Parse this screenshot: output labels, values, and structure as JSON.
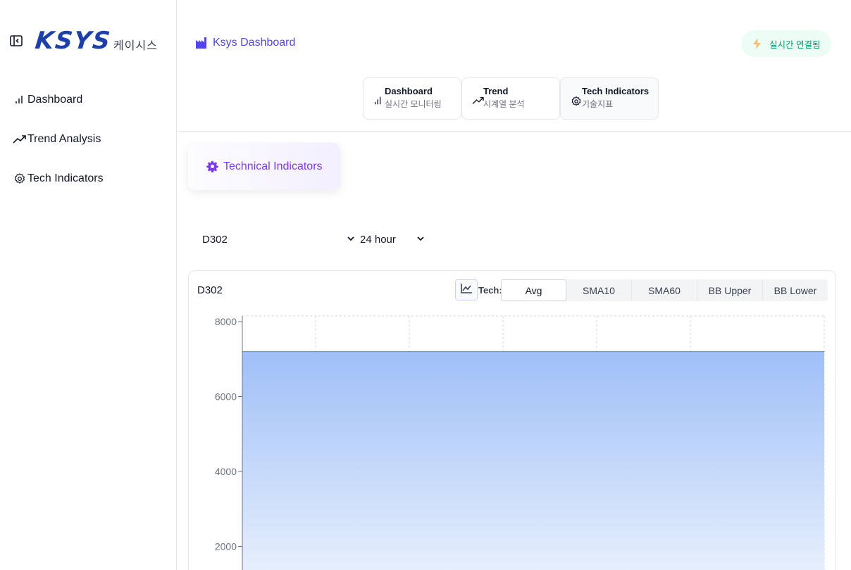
{
  "sidebar": {
    "logo_text": "KSYS",
    "logo_sub": "케이시스",
    "items": [
      {
        "label": "Dashboard",
        "icon": "bar-chart-icon"
      },
      {
        "label": "Trend Analysis",
        "icon": "trending-up-icon"
      },
      {
        "label": "Tech Indicators",
        "icon": "gear-icon"
      }
    ]
  },
  "header": {
    "brand": "Ksys Dashboard",
    "status": "실시간 연결됨"
  },
  "tabs": [
    {
      "title": "Dashboard",
      "subtitle": "실시간 모니터링",
      "icon": "bar-chart-icon"
    },
    {
      "title": "Trend",
      "subtitle": "시계열 분석",
      "icon": "trending-up-icon"
    },
    {
      "title": "Tech Indicators",
      "subtitle": "기술지표",
      "icon": "gear-icon",
      "active": true
    }
  ],
  "section": {
    "title": "Technical Indicators"
  },
  "filters": {
    "sensor": "D302",
    "range": "24 hour"
  },
  "chart": {
    "title": "D302",
    "tech_label": "Tech:",
    "buttons": [
      "Avg",
      "SMA10",
      "SMA60",
      "BB Upper",
      "BB Lower"
    ],
    "active_button": "Avg"
  },
  "chart_data": {
    "type": "area",
    "title": "D302",
    "series": [
      {
        "values": [
          7200,
          7200
        ]
      }
    ],
    "ylim": [
      0,
      8000
    ],
    "yticks": [
      2000,
      4000,
      6000,
      8000
    ],
    "grid": true,
    "colors": {
      "line": "#6b8ff0",
      "fill_top": "#9fbff7",
      "fill_bottom": "#e9f1fd"
    }
  }
}
